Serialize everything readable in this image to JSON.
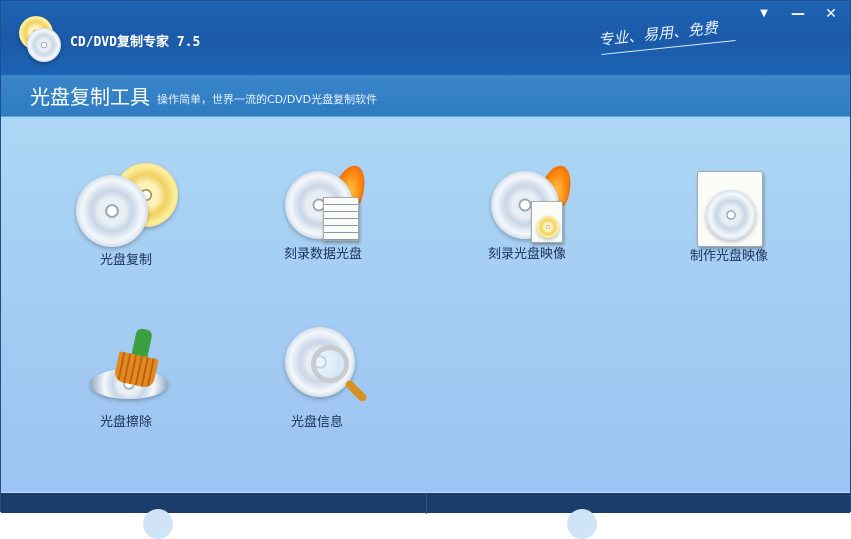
{
  "window": {
    "title": "CD/DVD复制专家 7.5",
    "slogan": "专业、易用、免费",
    "menu_icon": "▼",
    "minimize_icon": "—",
    "close_icon": "✕"
  },
  "header": {
    "title": "光盘复制工具",
    "description": "操作简单，世界一流的CD/DVD光盘复制软件"
  },
  "tools": [
    {
      "label": "光盘复制",
      "icon": "disc-copy-icon"
    },
    {
      "label": "刻录数据光盘",
      "icon": "burn-data-disc-icon"
    },
    {
      "label": "刻录光盘映像",
      "icon": "burn-disc-image-icon"
    },
    {
      "label": "制作光盘映像",
      "icon": "create-disc-image-icon"
    },
    {
      "label": "光盘擦除",
      "icon": "disc-erase-icon"
    },
    {
      "label": "光盘信息",
      "icon": "disc-info-icon"
    }
  ]
}
